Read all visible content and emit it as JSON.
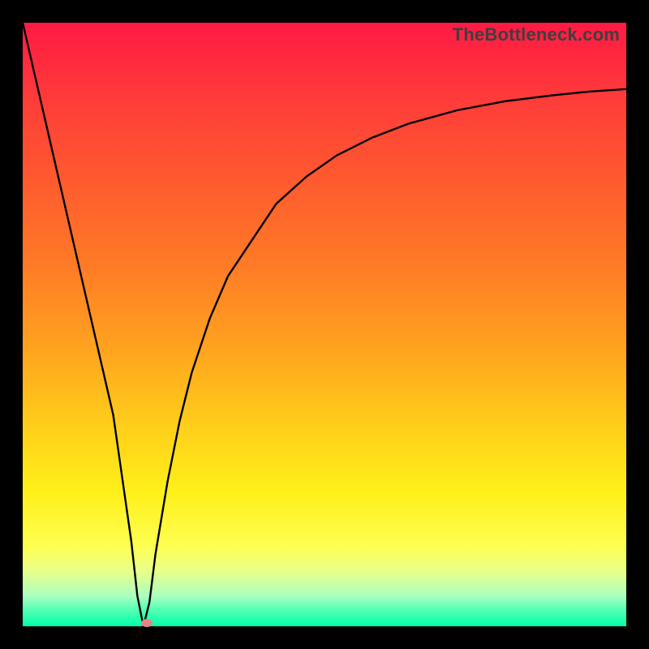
{
  "watermark": "TheBottleneck.com",
  "chart_data": {
    "type": "line",
    "title": "",
    "xlabel": "",
    "ylabel": "",
    "xlim": [
      0,
      100
    ],
    "ylim": [
      0,
      100
    ],
    "x": [
      0,
      3,
      6,
      9,
      12,
      15,
      18,
      19,
      20,
      21,
      22,
      24,
      26,
      28,
      31,
      34,
      38,
      42,
      47,
      52,
      58,
      64,
      72,
      80,
      88,
      94,
      100
    ],
    "values": [
      100,
      87,
      74,
      61,
      48,
      35,
      14,
      5,
      0,
      4,
      12,
      24,
      34,
      42,
      51,
      58,
      64,
      70,
      74.5,
      78,
      81,
      83.3,
      85.5,
      87,
      88,
      88.6,
      89
    ],
    "marker": {
      "x": 20.5,
      "y": 0.5
    },
    "background_gradient": {
      "top": "#ff1a44",
      "upper_mid": "#ff7a26",
      "mid": "#ffd21a",
      "lower_mid": "#fdff53",
      "bottom": "#00ffaa"
    }
  }
}
